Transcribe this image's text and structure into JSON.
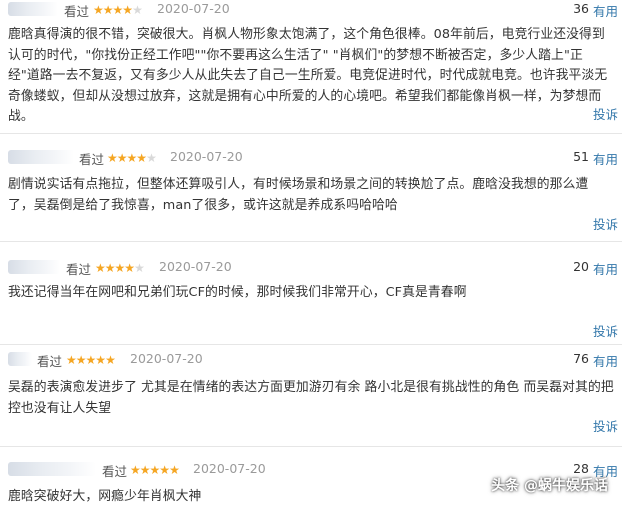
{
  "reviews": [
    {
      "watched_label": "看过",
      "rating": 4,
      "date": "2020-07-20",
      "votes": "36",
      "useful_label": "有用",
      "body": "鹿晗真得演的很不错，突破很大。肖枫人物形象太饱满了，这个角色很棒。08年前后，电竞行业还没得到认可的时代，\"你找份正经工作吧\"\"你不要再这么生活了\" \"肖枫们\"的梦想不断被否定，多少人踏上\"正经\"道路一去不复返，又有多少人从此失去了自己一生所爱。电竞促进时代，时代成就电竞。也许我平淡无奇像蝼蚁，但却从没想过放弃，这就是拥有心中所爱的人的心境吧。希望我们都能像肖枫一样，为梦想而战。",
      "report_label": "投诉"
    },
    {
      "watched_label": "看过",
      "rating": 4,
      "date": "2020-07-20",
      "votes": "51",
      "useful_label": "有用",
      "body": "剧情说实话有点拖拉，但整体还算吸引人，有时候场景和场景之间的转换尬了点。鹿晗没我想的那么遭了，吴磊倒是给了我惊喜，man了很多，或许这就是养成系吗哈哈哈",
      "report_label": "投诉"
    },
    {
      "watched_label": "看过",
      "rating": 4,
      "date": "2020-07-20",
      "votes": "20",
      "useful_label": "有用",
      "body": "我还记得当年在网吧和兄弟们玩CF的时候，那时候我们非常开心，CF真是青春啊",
      "report_label": "投诉"
    },
    {
      "watched_label": "看过",
      "rating": 5,
      "date": "2020-07-20",
      "votes": "76",
      "useful_label": "有用",
      "body": "吴磊的表演愈发进步了 尤其是在情绪的表达方面更加游刃有余 路小北是很有挑战性的角色 而吴磊对其的把控也没有让人失望",
      "report_label": "投诉"
    },
    {
      "watched_label": "看过",
      "rating": 5,
      "date": "2020-07-20",
      "votes": "28",
      "useful_label": "有用",
      "body": "鹿晗突破好大，网瘾少年肖枫大神",
      "report_label": ""
    }
  ],
  "watermark": "头条 @蜗牛娱乐话",
  "colors": {
    "star": "#f5a623",
    "link": "#3377aa",
    "date": "#9a9a9a"
  }
}
